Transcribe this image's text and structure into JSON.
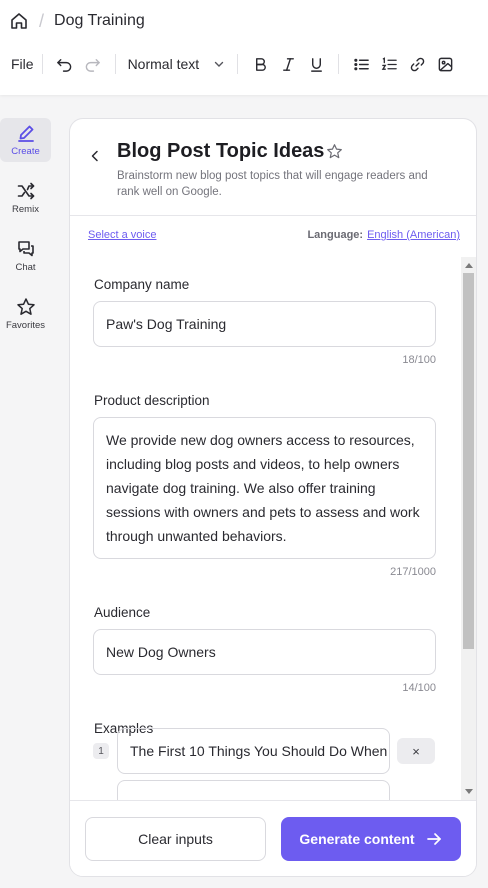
{
  "header": {
    "doc_title": "Dog Training"
  },
  "toolbar": {
    "file_label": "File",
    "text_style": "Normal text"
  },
  "rail": {
    "items": [
      {
        "label": "Create",
        "icon": "pen-icon",
        "active": true
      },
      {
        "label": "Remix",
        "icon": "shuffle-icon",
        "active": false
      },
      {
        "label": "Chat",
        "icon": "chat-icon",
        "active": false
      },
      {
        "label": "Favorites",
        "icon": "star-icon",
        "active": false
      }
    ]
  },
  "panel": {
    "title": "Blog Post Topic Ideas",
    "subtitle": "Brainstorm new blog post topics that will engage readers and rank well on Google.",
    "voice_link": "Select a voice",
    "language_label": "Language:",
    "language_value": "English (American)"
  },
  "form": {
    "company": {
      "label": "Company name",
      "value": "Paw's Dog Training",
      "counter": "18/100"
    },
    "product": {
      "label": "Product description",
      "value": "We provide new dog owners access to resources, including blog posts and videos, to help owners navigate dog training. We also offer training sessions with owners and pets to assess and work through unwanted behaviors.",
      "counter": "217/1000"
    },
    "audience": {
      "label": "Audience",
      "value": "New Dog Owners",
      "counter": "14/100"
    },
    "examples": {
      "label": "Examples",
      "items": [
        {
          "num": "1",
          "value": "The First 10 Things You Should Do When"
        }
      ],
      "remove_symbol": "×"
    }
  },
  "footer": {
    "clear_label": "Clear inputs",
    "generate_label": "Generate content"
  },
  "colors": {
    "accent": "#6d5cf0",
    "rail_active_bg": "#e6e6ea"
  }
}
